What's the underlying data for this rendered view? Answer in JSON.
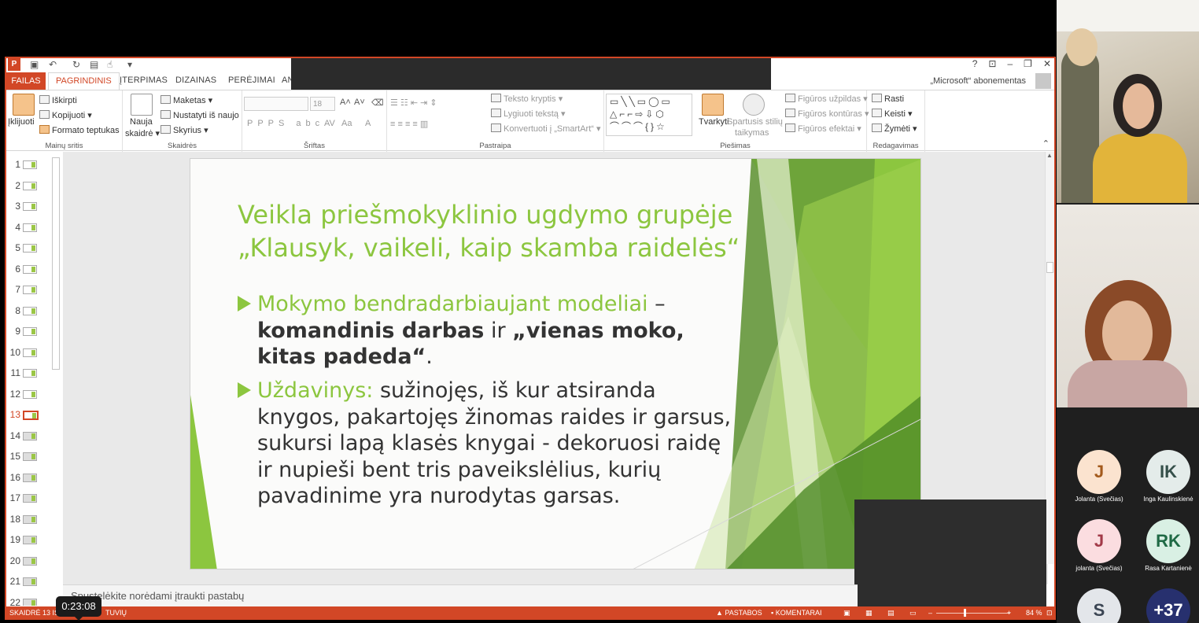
{
  "app": {
    "account": "„Microsoft“ abonementas",
    "tabs": [
      "FAILAS",
      "PAGRINDINIS",
      "ĮTERPIMAS",
      "DIZAINAS",
      "PERĖJIMAI",
      "AN"
    ],
    "active_tab": "PAGRINDINIS"
  },
  "ribbon": {
    "clipboard": {
      "paste": "Įklijuoti",
      "cut": "Iškirpti",
      "copy": "Kopijuoti",
      "format_painter": "Formato teptukas",
      "label": "Mainų sritis"
    },
    "slides": {
      "new_slide_1": "Nauja",
      "new_slide_2": "skaidrė",
      "layout": "Maketas",
      "reset": "Nustatyti iš naujo",
      "section": "Skyrius",
      "label": "Skaidrės"
    },
    "font": {
      "font_size": "18",
      "label": "Šriftas"
    },
    "paragraph": {
      "text_direction": "Teksto kryptis",
      "align_text": "Lygiuoti tekstą",
      "convert_smartart": "Konvertuoti į „SmartArt“",
      "label": "Pastraipa"
    },
    "drawing": {
      "arrange": "Tvarkyti",
      "quick_styles_1": "Spartusis stilių",
      "quick_styles_2": "taikymas",
      "shape_fill": "Figūros užpildas",
      "shape_outline": "Figūros kontūras",
      "shape_effects": "Figūros efektai",
      "label": "Piešimas"
    },
    "editing": {
      "find": "Rasti",
      "replace": "Keisti",
      "select": "Žymėti",
      "label": "Redagavimas"
    }
  },
  "thumbnails": {
    "items": [
      "1",
      "2",
      "3",
      "4",
      "5",
      "6",
      "7",
      "8",
      "9",
      "10",
      "11",
      "12",
      "13",
      "14",
      "15",
      "16",
      "17",
      "18",
      "19",
      "20",
      "21",
      "22"
    ],
    "active": 13
  },
  "slide": {
    "title_line1": "Veikla priešmokyklinio ugdymo grupėje",
    "title_line2": "„Klausyk, vaikeli, kaip skamba raidelės“",
    "bullet1": {
      "green": "Mokymo bendradarbiaujant modeliai",
      "sep": " – ",
      "bold1": "komandinis darbas",
      "mid": " ir ",
      "bold2": "„vienas moko, kitas padeda“",
      "end": "."
    },
    "bullet2": {
      "green": "Uždavinys:",
      "text": " sužinojęs, iš kur atsiranda knygos, pakartojęs žinomas raides ir garsus, sukursi lapą klasės knygai - dekoruosi raidę ir nupieši bent tris paveikslėlius, kurių pavadinime yra nurodytas garsas."
    }
  },
  "notes": {
    "placeholder": "Spustelėkite norėdami įtraukti pastabų"
  },
  "status": {
    "slide": "SKAIDRĖ 13 IŠ",
    "language": "TUVIŲ",
    "notes": "PASTABOS",
    "comments": "KOMENTARAI",
    "zoom": "84 %"
  },
  "time_tooltip": "0:23:08",
  "participants": {
    "list": [
      {
        "initials": "J",
        "name": "Jolanta (Svečias)",
        "bg": "#fbe3cf",
        "fg": "#a35a1c"
      },
      {
        "initials": "IK",
        "name": "Inga Kaulinskienė",
        "bg": "#e4ecea",
        "fg": "#35504a"
      },
      {
        "initials": "J",
        "name": "jolanta (Svečias)",
        "bg": "#fbdde0",
        "fg": "#a23a48"
      },
      {
        "initials": "RK",
        "name": "Rasa Kartanienė",
        "bg": "#d9f0e4",
        "fg": "#1f6a45"
      },
      {
        "initials": "S",
        "name": "",
        "bg": "#e3e6ea",
        "fg": "#3b4553"
      },
      {
        "initials": "+37",
        "name": "",
        "bg": "#27306e",
        "fg": "#ffffff"
      }
    ]
  },
  "colors": {
    "accent": "#d24726",
    "slide_green": "#8cc63f"
  }
}
